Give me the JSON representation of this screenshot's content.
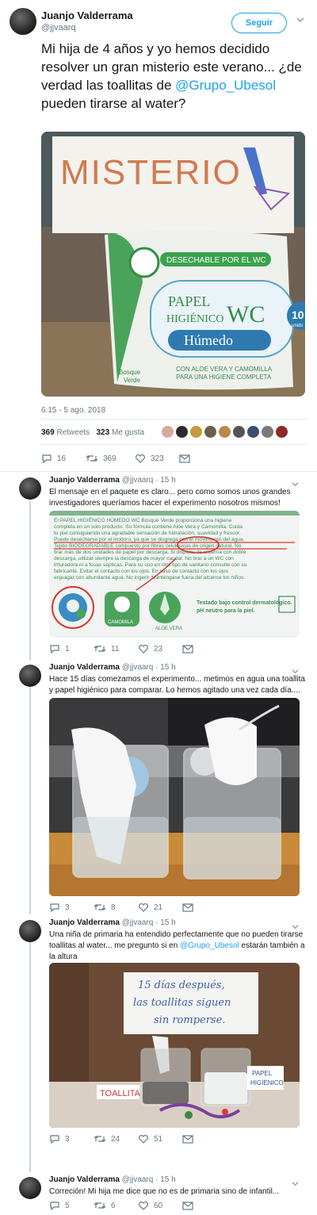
{
  "main_tweet": {
    "author_name": "Juanjo Valderrama",
    "handle": "@jjvaarq",
    "follow_label": "Seguir",
    "text_before": "Mi hija de 4 años y yo hemos decidido resolver un gran misterio este verano... ¿de verdad las toallitas de ",
    "mention": "@Grupo_Ubesol",
    "text_after": " pueden tirarse al water?",
    "image": {
      "sign_text": "MISTERIO",
      "pack_banner": "DESECHABLE POR EL WC",
      "pack_title_1": "PAPEL",
      "pack_title_2": "HIGIÉNICO",
      "pack_title_wc": "WC",
      "pack_subtitle": "Húmedo",
      "pack_brand_1": "Bosque",
      "pack_brand_2": "Verde",
      "pack_tagline_1": "CON ALOE VERA Y CAMOMILLA",
      "pack_tagline_2": "PARA UNA HIGIENE COMPLETA",
      "pack_count": "10",
      "pack_count_unit": "unids"
    },
    "timestamp": "6:15 - 5 ago. 2018",
    "retweets_count": "369",
    "retweets_label": "Retweets",
    "likes_count": "323",
    "likes_label": "Me gusta",
    "actions": {
      "replies": "16",
      "retweets": "369",
      "likes": "323"
    }
  },
  "replies": [
    {
      "author_name": "Juanjo Valderrama",
      "handle": "@jjvaarq",
      "time": "15 h",
      "text": "El mensaje en el paquete es claro... pero como somos unos grandes investigadores queríamos hacer el experimento nosotros mismos!",
      "image": {
        "lines": [
          "El PAPEL HIGIÉNICO HÚMEDO WC Bosque Verde proporciona una higiene",
          "completa en un solo producto. Su fórmula contiene Aloe Vera y Camomilla. Cuida",
          "tu piel consiguiendo una agradable sensación de hidratación, suavidad y frescor.",
          "Puede desecharse por el inodoro, ya que se disgrega con el movimiento del agua.",
          "Tejido BIODEGRADABLE compuesto por fibras celulósicas de origen natural. No",
          "tirar más de dos unidades de papel por descarga. Si dispone de cisterna con doble",
          "descarga, utilizar siempre la descarga de mayor caudal. No tirar a un WC con",
          "trituradora ni a fosas sépticas. Para su uso en otro tipo de sanitario consulte con su",
          "fabricante. Evitar el contacto con los ojos. En caso de contacto con los ojos",
          "enjuagar con abundante agua. No ingerir. Manténgase fuera del alcance los niños."
        ],
        "badge_1": "CAMOMILA",
        "badge_2": "ALOE VERA",
        "tested_1": "Testado bajo control dermatológico.",
        "tested_2": "pH neutro para la piel."
      },
      "actions": {
        "replies": "1",
        "retweets": "11",
        "likes": "23"
      }
    },
    {
      "author_name": "Juanjo Valderrama",
      "handle": "@jjvaarq",
      "time": "15 h",
      "text": "Hace 15 días comezamos el experimento... metimos en agua una toallita y papel higiénico para comparar. Lo hemos agitado una vez cada día....",
      "actions": {
        "replies": "3",
        "retweets": "8",
        "likes": "21"
      }
    },
    {
      "author_name": "Juanjo Valderrama",
      "handle": "@jjvaarq",
      "time": "15 h",
      "text_before": "Una niña de primaria ha entendido perfectamente que no pueden tirarse toallitas al water... me pregunto si en ",
      "mention": "@Grupo_Ubesol",
      "text_after": " estarán también a la altura",
      "image": {
        "note_1": "15 días después,",
        "note_2": "las toallitas siguen",
        "note_3": "sin romperse.",
        "label_left": "TOALLITA",
        "label_right_1": "PAPEL",
        "label_right_2": "HIGIÉNICO"
      },
      "actions": {
        "replies": "3",
        "retweets": "24",
        "likes": "51"
      }
    },
    {
      "author_name": "Juanjo Valderrama",
      "handle": "@jjvaarq",
      "time": "15 h",
      "text": "Correción! Mi hija me dice que no es de primaria sino de infantil...",
      "actions": {
        "replies": "5",
        "retweets": "6",
        "likes": "60"
      }
    }
  ],
  "colors": {
    "accent": "#1da1f2",
    "text": "#14171a",
    "secondary": "#657786",
    "divider": "#e6ecf0"
  },
  "icons": [
    "reply-icon",
    "retweet-icon",
    "like-icon",
    "message-icon",
    "chevron-down-icon"
  ]
}
